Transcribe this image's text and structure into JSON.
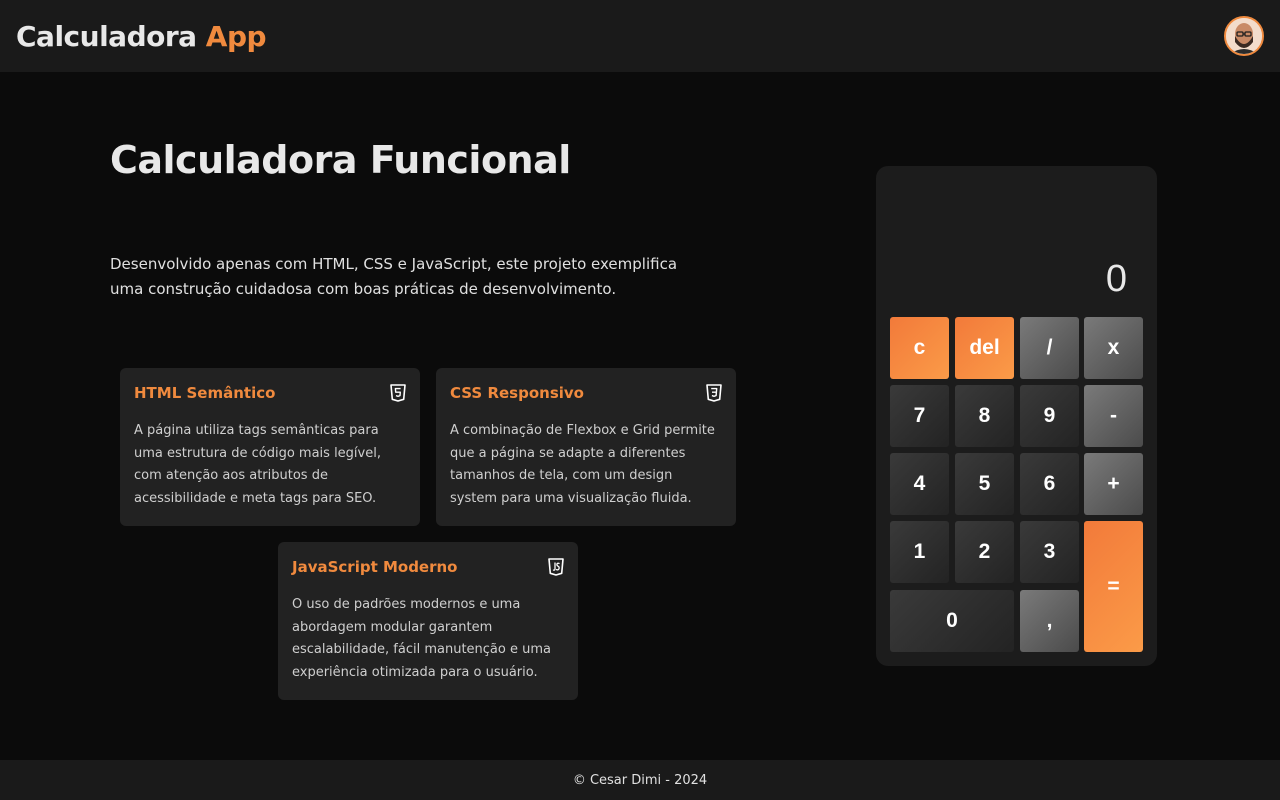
{
  "header": {
    "brand_main": "Calculadora",
    "brand_accent": "App",
    "avatar_icon": "user-avatar-icon"
  },
  "hero": {
    "title": "Calculadora Funcional",
    "description": "Desenvolvido apenas com HTML, CSS e JavaScript, este projeto exemplifica uma construção cuidadosa com boas práticas de desenvolvimento."
  },
  "cards": [
    {
      "title": "HTML Semântico",
      "icon": "html5-icon",
      "text": "A página utiliza tags semânticas para uma estrutura de código mais legível, com atenção aos atributos de acessibilidade e meta tags para SEO."
    },
    {
      "title": "CSS Responsivo",
      "icon": "css3-icon",
      "text": "A combinação de Flexbox e Grid permite que a página se adapte a diferentes tamanhos de tela, com um design system para uma visualização fluida."
    },
    {
      "title": "JavaScript Moderno",
      "icon": "javascript-icon",
      "text": "O uso de padrões modernos e uma abordagem modular garantem escalabilidade, fácil manutenção e uma experiência otimizada para o usuário."
    }
  ],
  "calculator": {
    "display": "0",
    "keys": {
      "clear": "c",
      "delete": "del",
      "divide": "/",
      "multiply": "x",
      "seven": "7",
      "eight": "8",
      "nine": "9",
      "minus": "-",
      "four": "4",
      "five": "5",
      "six": "6",
      "plus": "+",
      "one": "1",
      "two": "2",
      "three": "3",
      "equals": "=",
      "zero": "0",
      "comma": ","
    }
  },
  "footer": {
    "text": "© Cesar Dimi - 2024"
  },
  "colors": {
    "accent": "#f08a3e",
    "background": "#0b0b0b",
    "surface": "#1a1a1a",
    "card": "#222222"
  }
}
